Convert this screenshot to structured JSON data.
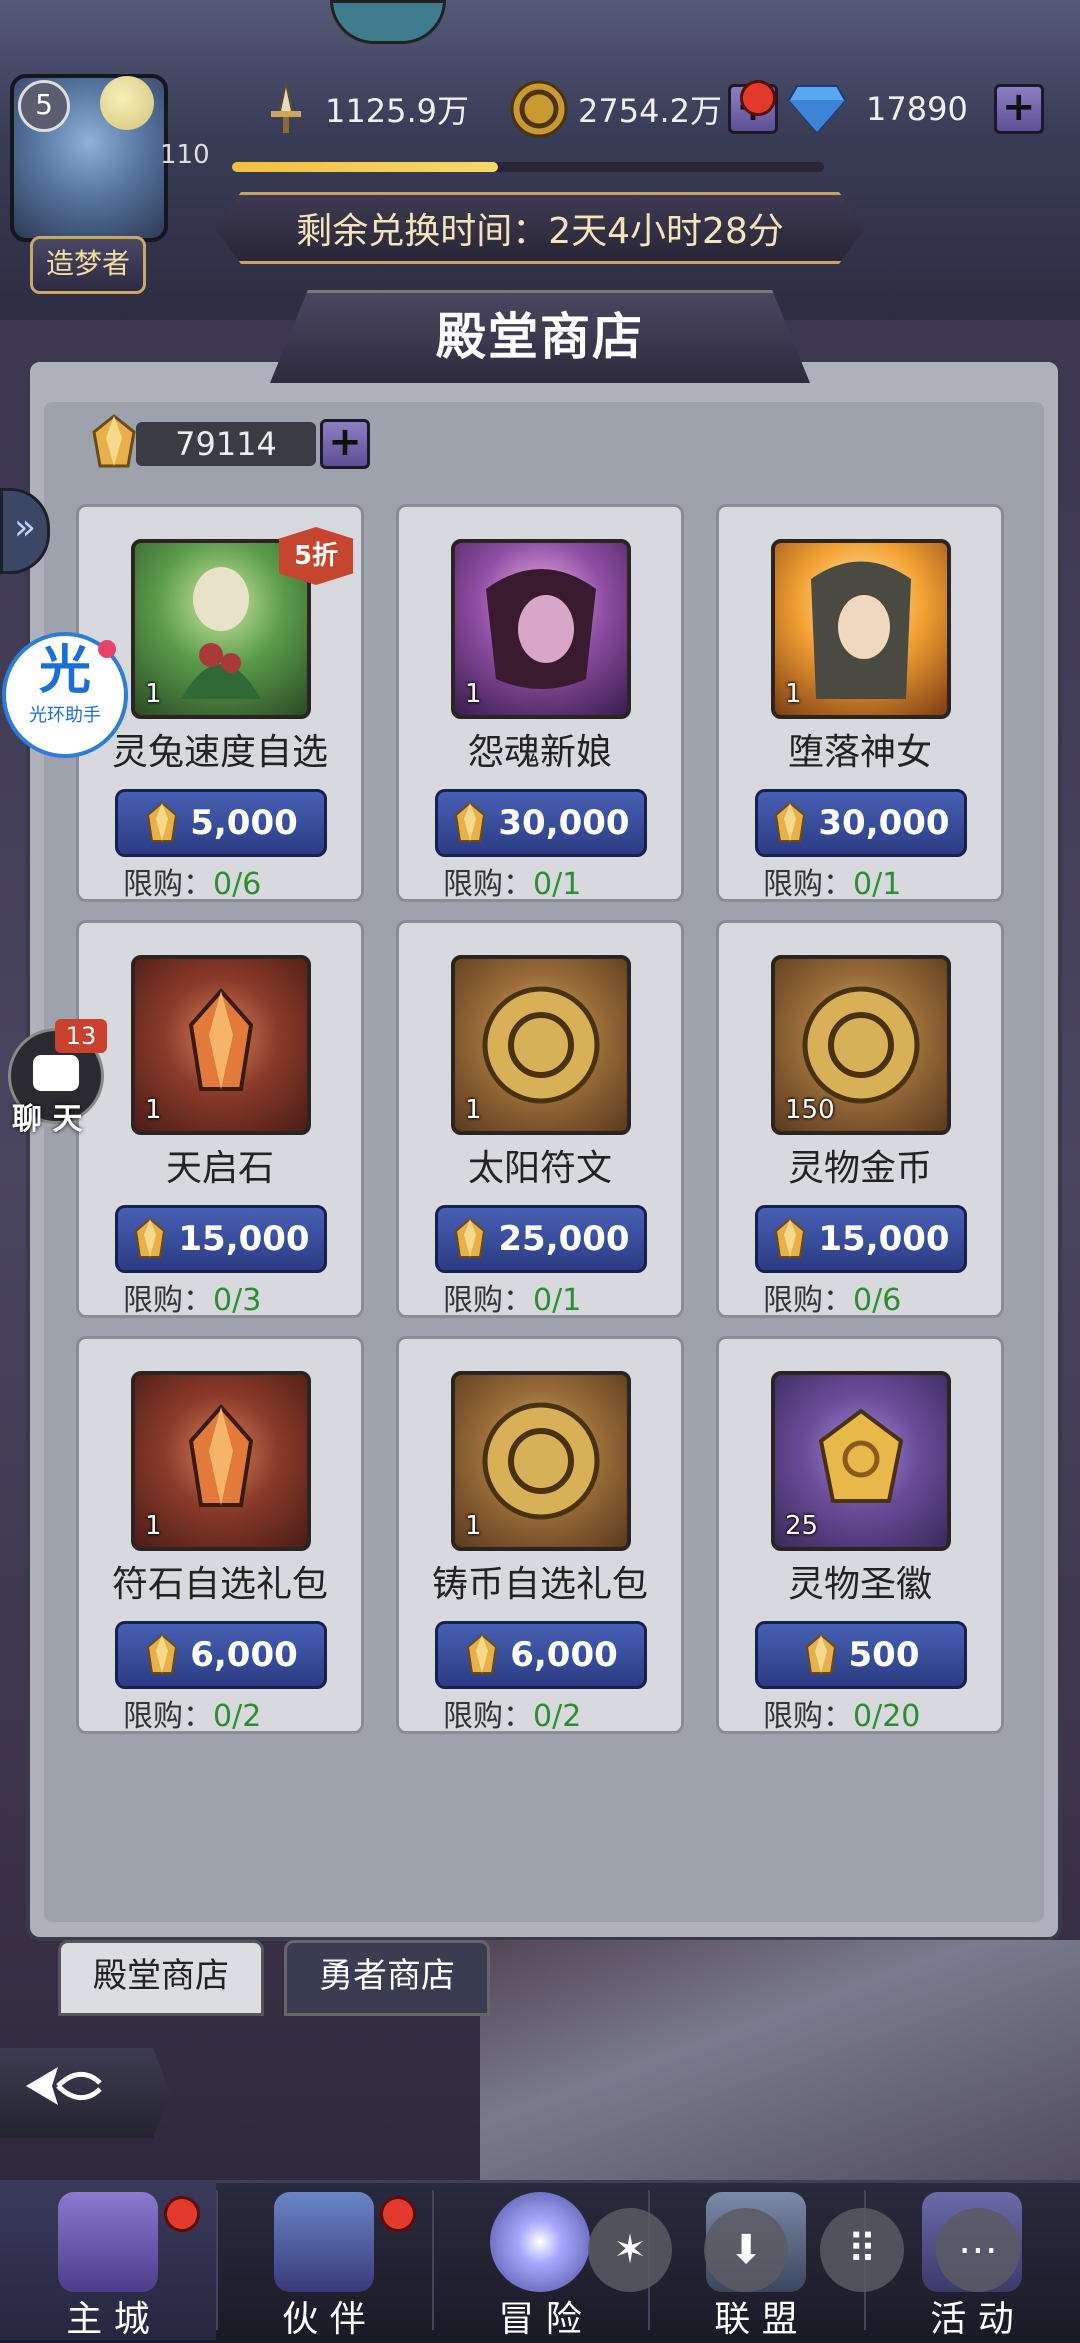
{
  "hud": {
    "avatar_level": "5",
    "player_level": "110",
    "title_badge": "造梦者",
    "power": "1125.9万",
    "gold": "2754.2万",
    "diamonds": "17890",
    "xp_fraction": 0.45,
    "timer_text": "剩余兑换时间：2天4小时28分"
  },
  "shop": {
    "title": "殿堂商店",
    "currency_amount": "79114",
    "limit_label": "限购："
  },
  "items": [
    {
      "name": "灵兔速度自选",
      "qty": "1",
      "price": "5,000",
      "limit": "0/6",
      "discount": "5折",
      "art": "green"
    },
    {
      "name": "怨魂新娘",
      "qty": "1",
      "price": "30,000",
      "limit": "0/1",
      "art": "purple"
    },
    {
      "name": "堕落神女",
      "qty": "1",
      "price": "30,000",
      "limit": "0/1",
      "art": "orange"
    },
    {
      "name": "天启石",
      "qty": "1",
      "price": "15,000",
      "limit": "0/3",
      "art": "red"
    },
    {
      "name": "太阳符文",
      "qty": "1",
      "price": "25,000",
      "limit": "0/1",
      "art": "brown"
    },
    {
      "name": "灵物金币",
      "qty": "150",
      "price": "15,000",
      "limit": "0/6",
      "art": "brown"
    },
    {
      "name": "符石自选礼包",
      "qty": "1",
      "price": "6,000",
      "limit": "0/2",
      "art": "red"
    },
    {
      "name": "铸币自选礼包",
      "qty": "1",
      "price": "6,000",
      "limit": "0/2",
      "art": "brown"
    },
    {
      "name": "灵物圣徽",
      "qty": "25",
      "price": "500",
      "limit": "0/20",
      "art": "violet"
    }
  ],
  "tabs": {
    "active": "殿堂商店",
    "inactive": "勇者商店"
  },
  "widgets": {
    "guanghuan_glyph": "光",
    "guanghuan_label": "光环助手",
    "chat_badge": "13",
    "chat_label": "聊 天"
  },
  "nav": [
    {
      "label": "主 城"
    },
    {
      "label": "伙 伴"
    },
    {
      "label": "冒 险"
    },
    {
      "label": "联 盟"
    },
    {
      "label": "活 动"
    }
  ],
  "colors": {
    "price_button": "#3a4fa0",
    "limit_count": "#2a8f30",
    "discount_badge": "#c6452f",
    "red_dot": "#e23b2e"
  }
}
